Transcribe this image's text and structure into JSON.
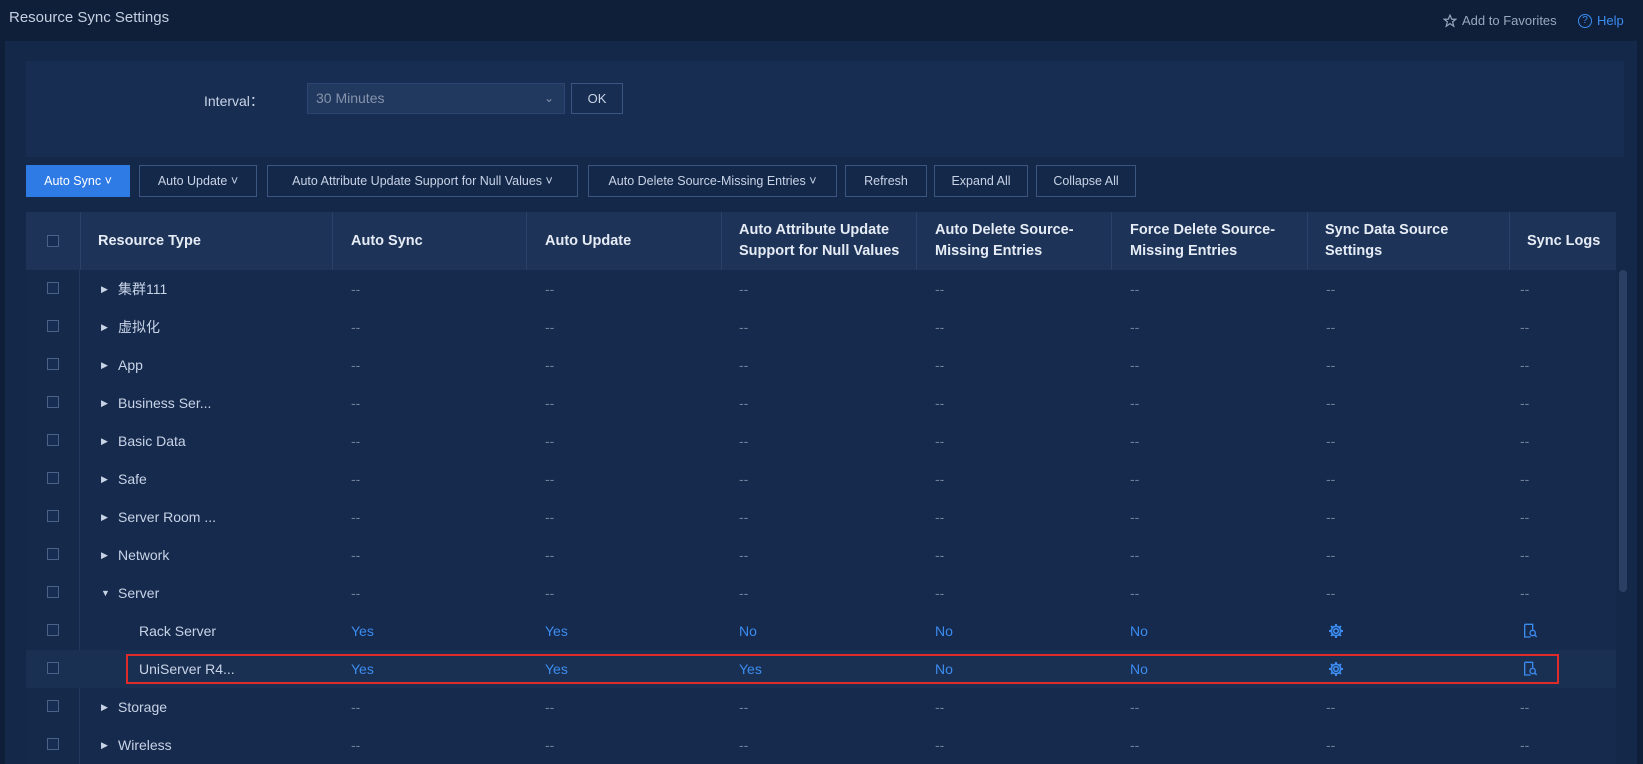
{
  "header": {
    "title": "Resource Sync Settings",
    "add_favorites": "Add to Favorites",
    "help": "Help"
  },
  "filter": {
    "interval_label": "Interval：",
    "interval_value": "30 Minutes",
    "ok_label": "OK"
  },
  "toolbar": {
    "auto_sync": "Auto Sync",
    "auto_update": "Auto Update",
    "auto_attr_null": "Auto Attribute Update Support for Null Values",
    "auto_delete": "Auto Delete Source-Missing Entries",
    "refresh": "Refresh",
    "expand_all": "Expand All",
    "collapse_all": "Collapse All"
  },
  "table": {
    "headers": {
      "resource_type": "Resource Type",
      "auto_sync": "Auto Sync",
      "auto_update": "Auto Update",
      "auto_attr_line1": "Auto Attribute Update",
      "auto_attr_line2": "Support for Null Values",
      "auto_delete_line1": "Auto Delete Source-",
      "auto_delete_line2": "Missing Entries",
      "force_delete_line1": "Force Delete Source-",
      "force_delete_line2": "Missing Entries",
      "sync_ds_line1": "Sync Data Source",
      "sync_ds_line2": "Settings",
      "sync_logs": "Sync Logs"
    },
    "rows": [
      {
        "name": "集群111",
        "auto_sync": "--",
        "auto_update": "--",
        "auto_attr": "--",
        "auto_delete": "--",
        "force_delete": "--",
        "sync_ds": "--",
        "sync_logs": "--"
      },
      {
        "name": "虚拟化",
        "auto_sync": "--",
        "auto_update": "--",
        "auto_attr": "--",
        "auto_delete": "--",
        "force_delete": "--",
        "sync_ds": "--",
        "sync_logs": "--"
      },
      {
        "name": "App",
        "auto_sync": "--",
        "auto_update": "--",
        "auto_attr": "--",
        "auto_delete": "--",
        "force_delete": "--",
        "sync_ds": "--",
        "sync_logs": "--"
      },
      {
        "name": "Business Ser...",
        "auto_sync": "--",
        "auto_update": "--",
        "auto_attr": "--",
        "auto_delete": "--",
        "force_delete": "--",
        "sync_ds": "--",
        "sync_logs": "--"
      },
      {
        "name": "Basic Data",
        "auto_sync": "--",
        "auto_update": "--",
        "auto_attr": "--",
        "auto_delete": "--",
        "force_delete": "--",
        "sync_ds": "--",
        "sync_logs": "--"
      },
      {
        "name": "Safe",
        "auto_sync": "--",
        "auto_update": "--",
        "auto_attr": "--",
        "auto_delete": "--",
        "force_delete": "--",
        "sync_ds": "--",
        "sync_logs": "--"
      },
      {
        "name": "Server Room ...",
        "auto_sync": "--",
        "auto_update": "--",
        "auto_attr": "--",
        "auto_delete": "--",
        "force_delete": "--",
        "sync_ds": "--",
        "sync_logs": "--"
      },
      {
        "name": "Network",
        "auto_sync": "--",
        "auto_update": "--",
        "auto_attr": "--",
        "auto_delete": "--",
        "force_delete": "--",
        "sync_ds": "--",
        "sync_logs": "--"
      },
      {
        "name": "Server",
        "auto_sync": "--",
        "auto_update": "--",
        "auto_attr": "--",
        "auto_delete": "--",
        "force_delete": "--",
        "sync_ds": "--",
        "sync_logs": "--"
      },
      {
        "name": "Rack Server",
        "auto_sync": "Yes",
        "auto_update": "Yes",
        "auto_attr": "No",
        "auto_delete": "No",
        "force_delete": "No"
      },
      {
        "name": "UniServer R4...",
        "auto_sync": "Yes",
        "auto_update": "Yes",
        "auto_attr": "Yes",
        "auto_delete": "No",
        "force_delete": "No"
      },
      {
        "name": "Storage",
        "auto_sync": "--",
        "auto_update": "--",
        "auto_attr": "--",
        "auto_delete": "--",
        "force_delete": "--",
        "sync_ds": "--",
        "sync_logs": "--"
      },
      {
        "name": "Wireless",
        "auto_sync": "--",
        "auto_update": "--",
        "auto_attr": "--",
        "auto_delete": "--",
        "force_delete": "--",
        "sync_ds": "--",
        "sync_logs": "--"
      }
    ]
  },
  "colors": {
    "accent": "#2e7be6",
    "link": "#3c8cf0",
    "highlight_border": "#e02b2b"
  }
}
